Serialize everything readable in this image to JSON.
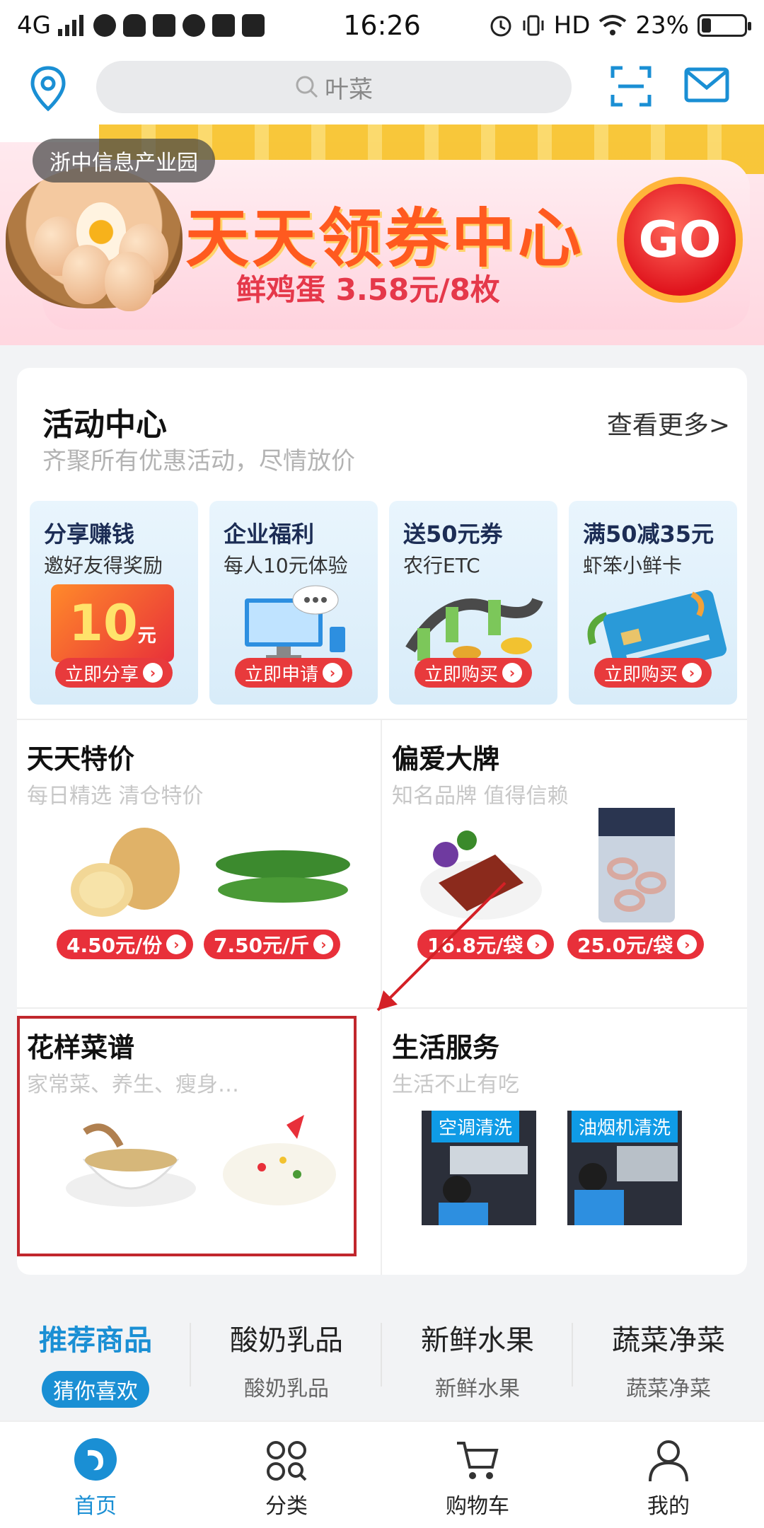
{
  "status_bar": {
    "network": "4G",
    "time": "16:26",
    "hd": "HD",
    "battery": "23%",
    "battery_level": 0.23
  },
  "header": {
    "search_placeholder": "叶菜"
  },
  "banner": {
    "location": "浙中信息产业园",
    "title": "天天领券中心",
    "subtitle": "鲜鸡蛋 3.58元/8枚",
    "go": "GO"
  },
  "activity": {
    "title": "活动中心",
    "subtitle": "齐聚所有优惠活动，尽情放价",
    "more": "查看更多>",
    "promos": [
      {
        "title": "分享赚钱",
        "desc": "邀好友得奖励",
        "art": "10",
        "art_unit": "元",
        "button": "立即分享"
      },
      {
        "title": "企业福利",
        "desc": "每人10元体验",
        "button": "立即申请"
      },
      {
        "title": "送50元券",
        "desc": "农行ETC",
        "button": "立即购买"
      },
      {
        "title": "满50减35元",
        "desc": "虾笨小鲜卡",
        "button": "立即购买"
      }
    ]
  },
  "sections": {
    "daily": {
      "title": "天天特价",
      "subtitle": "每日精选 清仓特价",
      "prices": [
        "4.50元/份",
        "7.50元/斤"
      ]
    },
    "brand": {
      "title": "偏爱大牌",
      "subtitle": "知名品牌 值得信赖",
      "prices": [
        "16.8元/袋",
        "25.0元/袋"
      ]
    },
    "recipe": {
      "title": "花样菜谱",
      "subtitle": "家常菜、养生、瘦身…"
    },
    "life": {
      "title": "生活服务",
      "subtitle": "生活不止有吃",
      "services": [
        "空调清洗",
        "油烟机清洗"
      ]
    }
  },
  "tabs": [
    {
      "name": "推荐商品",
      "sub": "猜你喜欢"
    },
    {
      "name": "酸奶乳品",
      "sub": "酸奶乳品"
    },
    {
      "name": "新鲜水果",
      "sub": "新鲜水果"
    },
    {
      "name": "蔬菜净菜",
      "sub": "蔬菜净菜"
    }
  ],
  "bottom_nav": [
    {
      "label": "首页",
      "icon": "shrimp-home-icon"
    },
    {
      "label": "分类",
      "icon": "category-icon"
    },
    {
      "label": "购物车",
      "icon": "cart-icon"
    },
    {
      "label": "我的",
      "icon": "profile-icon"
    }
  ],
  "colors": {
    "accent": "#1a8fd4",
    "price_red": "#e8303a",
    "highlight_box": "#c1272d"
  }
}
